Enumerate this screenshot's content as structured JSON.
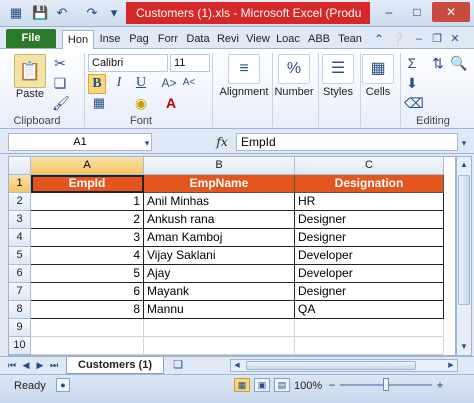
{
  "window": {
    "title": "Customers (1).xls  -  Microsoft Excel (Produ",
    "minimize": "–",
    "maximize": "□",
    "close": "✕"
  },
  "quick_access": {
    "save_icon": "save-icon",
    "undo_icon": "undo-icon",
    "redo_icon": "redo-icon"
  },
  "tabs": [
    "File",
    "Hon",
    "Inse",
    "Pag",
    "Forr",
    "Data",
    "Revi",
    "View",
    "Loac",
    "ABB",
    "Tean"
  ],
  "ribbon": {
    "clipboard": {
      "paste": "Paste",
      "group": "Clipboard"
    },
    "font": {
      "name": "Calibri",
      "size": "11",
      "bold": "B",
      "italic": "I",
      "underline": "U",
      "group": "Font"
    },
    "alignment": {
      "label": "Alignment"
    },
    "number": {
      "label": "Number",
      "icon_text": "%"
    },
    "styles": {
      "label": "Styles"
    },
    "cells": {
      "label": "Cells"
    },
    "editing": {
      "group": "Editing",
      "sum": "Σ"
    }
  },
  "formula_bar": {
    "name_box": "A1",
    "fx": "fx",
    "value": "EmpId"
  },
  "sheet": {
    "columns": [
      "A",
      "B",
      "C"
    ],
    "rows": [
      "1",
      "2",
      "3",
      "4",
      "5",
      "6",
      "7",
      "8",
      "9",
      "10"
    ],
    "headers": [
      "EmpId",
      "EmpName",
      "Designation"
    ],
    "data": [
      [
        "1",
        "Anil Minhas",
        "HR"
      ],
      [
        "2",
        "Ankush rana",
        "Designer"
      ],
      [
        "3",
        "Aman Kamboj",
        "Designer"
      ],
      [
        "4",
        "Vijay Saklani",
        "Developer"
      ],
      [
        "5",
        "Ajay",
        "Developer"
      ],
      [
        "6",
        "Mayank",
        "Designer"
      ],
      [
        "8",
        "Mannu",
        "QA"
      ]
    ],
    "header_color": "#e4561d"
  },
  "sheet_tabs": {
    "active": "Customers (1)"
  },
  "status": {
    "text": "Ready",
    "zoom": "100%",
    "zoom_out": "−",
    "zoom_in": "+"
  }
}
